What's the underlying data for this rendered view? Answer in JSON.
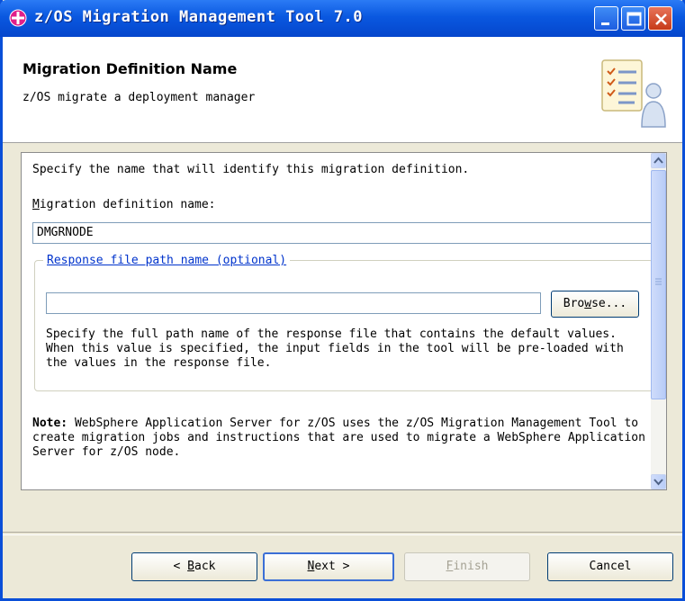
{
  "window": {
    "title": "z/OS Migration Management Tool 7.0",
    "controls": [
      "minimize",
      "maximize",
      "close"
    ]
  },
  "header": {
    "title": "Migration Definition Name",
    "subtitle": "z/OS migrate a deployment manager",
    "illustration_icon": "wizard-checklist-user-icon"
  },
  "content": {
    "intro": "Specify the name that will identify this migration definition.",
    "name_label_mnemonic": "M",
    "name_label_rest": "igration definition name:",
    "name_value": "DMGRNODE",
    "response_group_label": "Response file path name (optional)",
    "response_value": "",
    "browse_pre": "Bro",
    "browse_mnemonic": "w",
    "browse_post": "se...",
    "response_desc": "Specify the full path name of the response file that contains the default values. When this value is specified, the input fields in the tool will be pre-loaded with the values in the response file.",
    "note_label": "Note:",
    "note_text": " WebSphere Application Server for z/OS uses the z/OS Migration Management Tool to create migration jobs and instructions that are used to migrate a WebSphere Application Server for z/OS node."
  },
  "buttons": {
    "back_prefix": "< ",
    "back_mnemonic": "B",
    "back_rest": "ack",
    "next_mnemonic": "N",
    "next_rest": "ext >",
    "finish_mnemonic": "F",
    "finish_rest": "inish",
    "cancel_label": "Cancel"
  },
  "colors": {
    "titlebar": "#0a58e0",
    "accent_link": "#0033cc",
    "dialog_bg": "#ece9d8"
  }
}
